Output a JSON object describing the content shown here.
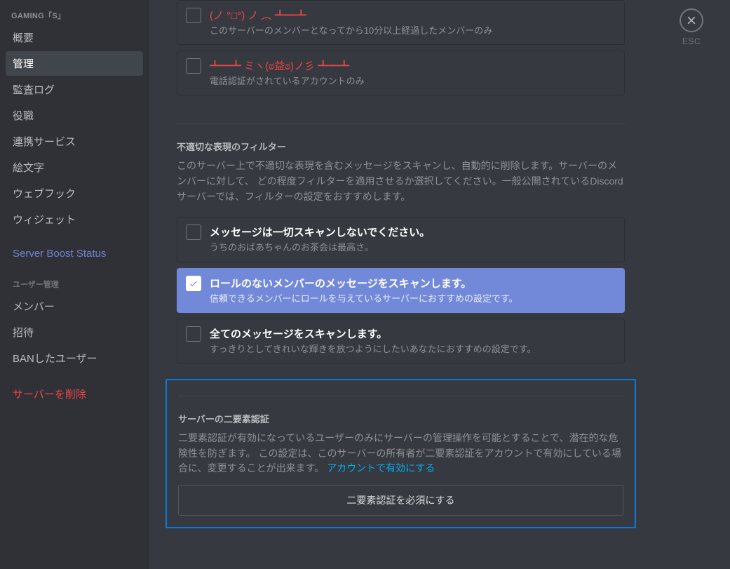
{
  "sidebar": {
    "header": "GAMING「S」",
    "items": [
      {
        "label": "概要"
      },
      {
        "label": "管理",
        "active": true
      },
      {
        "label": "監査ログ"
      },
      {
        "label": "役職"
      },
      {
        "label": "連携サービス"
      },
      {
        "label": "絵文字"
      },
      {
        "label": "ウェブフック"
      },
      {
        "label": "ウィジェット"
      }
    ],
    "boost": "Server Boost Status",
    "subheader": "ユーザー管理",
    "sub_items": [
      {
        "label": "メンバー"
      },
      {
        "label": "招待"
      },
      {
        "label": "BANしたユーザー"
      }
    ],
    "delete": "サーバーを削除"
  },
  "verification_options": [
    {
      "title": "(ノ °□°) ノ ︵ ┻━┻",
      "desc": "このサーバーのメンバーとなってから10分以上経過したメンバーのみ",
      "kaomoji": true
    },
    {
      "title": "┻━┻ ミヽ(ಠ益ಠ)ノ彡 ┻━┻",
      "desc": "電話認証がされているアカウントのみ",
      "kaomoji": true
    }
  ],
  "filter": {
    "heading": "不適切な表現のフィルター",
    "desc": "このサーバー上で不適切な表現を含むメッセージをスキャンし、自動的に削除します。サーバーのメンバーに対して、 どの程度フィルターを適用させるか選択してください。一般公開されているDiscordサーバーでは、フィルターの設定をおすすめします。",
    "options": [
      {
        "title": "メッセージは一切スキャンしないでください。",
        "desc": "うちのおばあちゃんのお茶会は最高さ。"
      },
      {
        "title": "ロールのないメンバーのメッセージをスキャンします。",
        "desc": "信頼できるメンバーにロールを与えているサーバーにおすすめの設定です。",
        "selected": true
      },
      {
        "title": "全てのメッセージをスキャンします。",
        "desc": "すっきりとしてきれいな輝きを放つようにしたいあなたにおすすめの設定です。"
      }
    ]
  },
  "mfa": {
    "heading": "サーバーの二要素認証",
    "desc_prefix": "二要素認証が有効になっているユーザーのみにサーバーの管理操作を可能とすることで、潜在的な危険性を防ぎます。 この設定は、このサーバーの所有者が二要素認証をアカウントで有効にしている場合に、変更することが出来ます。",
    "link": "アカウントで有効にする",
    "button": "二要素認証を必須にする"
  },
  "close": {
    "label": "ESC"
  }
}
